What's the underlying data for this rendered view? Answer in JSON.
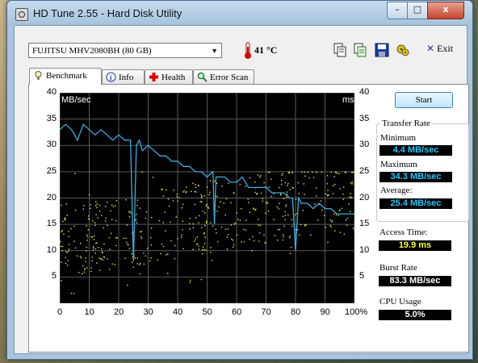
{
  "window": {
    "title": "HD Tune 2.55 - Hard Disk Utility",
    "min": "–",
    "max": "□",
    "close": "x"
  },
  "toolbar": {
    "drive": "FUJITSU MHV2080BH (80 GB)",
    "temperature": "41 °C",
    "exit_label": "Exit"
  },
  "tabs": [
    {
      "label": "Benchmark",
      "icon": "lightbulb-icon"
    },
    {
      "label": "Info",
      "icon": "info-icon"
    },
    {
      "label": "Health",
      "icon": "health-cross-icon"
    },
    {
      "label": "Error Scan",
      "icon": "magnifier-icon"
    }
  ],
  "chart": {
    "left_unit": "MB/sec",
    "right_unit": "ms",
    "left_ticks": [
      "40",
      "35",
      "30",
      "25",
      "20",
      "15",
      "10",
      "5"
    ],
    "right_ticks": [
      "40",
      "35",
      "30",
      "25",
      "20",
      "15",
      "10",
      "5"
    ],
    "x_ticks": [
      "0",
      "10",
      "20",
      "30",
      "40",
      "50",
      "60",
      "70",
      "80",
      "90",
      "100%"
    ]
  },
  "chart_data": {
    "type": "line",
    "x": [
      0,
      2,
      4,
      6,
      8,
      10,
      12,
      14,
      16,
      18,
      20,
      22,
      24,
      25,
      26,
      27,
      28,
      30,
      32,
      34,
      36,
      38,
      40,
      42,
      44,
      46,
      48,
      50,
      52,
      52.5,
      53,
      54,
      56,
      58,
      60,
      62,
      64,
      66,
      68,
      70,
      72,
      74,
      76,
      78,
      79,
      80,
      81,
      82,
      84,
      86,
      88,
      90,
      92,
      94,
      96,
      98,
      100
    ],
    "series": [
      {
        "name": "transfer-rate",
        "values": [
          33,
          34,
          33,
          31,
          34,
          33,
          32,
          33,
          32,
          31,
          32,
          31,
          31,
          8,
          30,
          31,
          29,
          30,
          29,
          28,
          28,
          27,
          27,
          26,
          26,
          25,
          25,
          24,
          25,
          15,
          24,
          24,
          24,
          23,
          23,
          24,
          22,
          22,
          22,
          22,
          21,
          21,
          21,
          20,
          20,
          10,
          20,
          19,
          19,
          18,
          19,
          18,
          18,
          17,
          17,
          17,
          17
        ]
      }
    ],
    "xlabel": "",
    "ylabel": "MB/sec",
    "ylabel_right": "ms",
    "xlim": [
      0,
      100
    ],
    "ylim": [
      0,
      40
    ],
    "grid": true,
    "access_points_ms_range": [
      2,
      25
    ],
    "colors": {
      "transfer": "#3aaee0",
      "access": "#e8e84a",
      "grid": "#5a5a5a",
      "background": "#000000"
    }
  },
  "controls": {
    "start": "Start"
  },
  "transfer_rate": {
    "title": "Transfer Rate",
    "minimum_label": "Minimum",
    "minimum": "4.4 MB/sec",
    "maximum_label": "Maximum",
    "maximum": "34.3 MB/sec",
    "average_label": "Average:",
    "average": "25.4 MB/sec"
  },
  "stats": {
    "access_label": "Access Time:",
    "access": "19.9 ms",
    "burst_label": "Burst Rate",
    "burst": "83.3 MB/sec",
    "cpu_label": "CPU Usage",
    "cpu": "5.0%"
  }
}
